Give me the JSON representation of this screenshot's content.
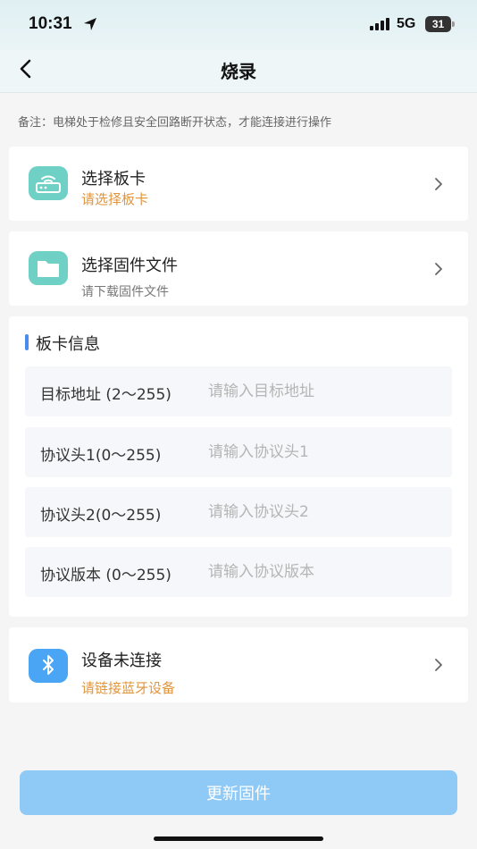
{
  "status": {
    "time": "10:31",
    "network": "5G",
    "battery": "31"
  },
  "nav": {
    "title": "烧录"
  },
  "note": "备注：电梯处于检修且安全回路断开状态，才能连接进行操作",
  "board": {
    "title": "选择板卡",
    "subtitle": "请选择板卡"
  },
  "firmware": {
    "title": "选择固件文件",
    "subtitle": "请下载固件文件"
  },
  "info": {
    "title": "板卡信息",
    "fields": [
      {
        "label": "目标地址 (2～255)",
        "placeholder": "请输入目标地址"
      },
      {
        "label": "协议头1(0～255)",
        "placeholder": "请输入协议头1"
      },
      {
        "label": "协议头2(0～255)",
        "placeholder": "请输入协议头2"
      },
      {
        "label": "协议版本 (0～255)",
        "placeholder": "请输入协议版本"
      }
    ]
  },
  "bluetooth": {
    "title": "设备未连接",
    "subtitle": "请链接蓝牙设备"
  },
  "update_button": "更新固件",
  "colors": {
    "accent_orange": "#e0953c",
    "teal": "#6fd0c5",
    "blue": "#4aa6f4",
    "button": "#8fcaf7"
  }
}
